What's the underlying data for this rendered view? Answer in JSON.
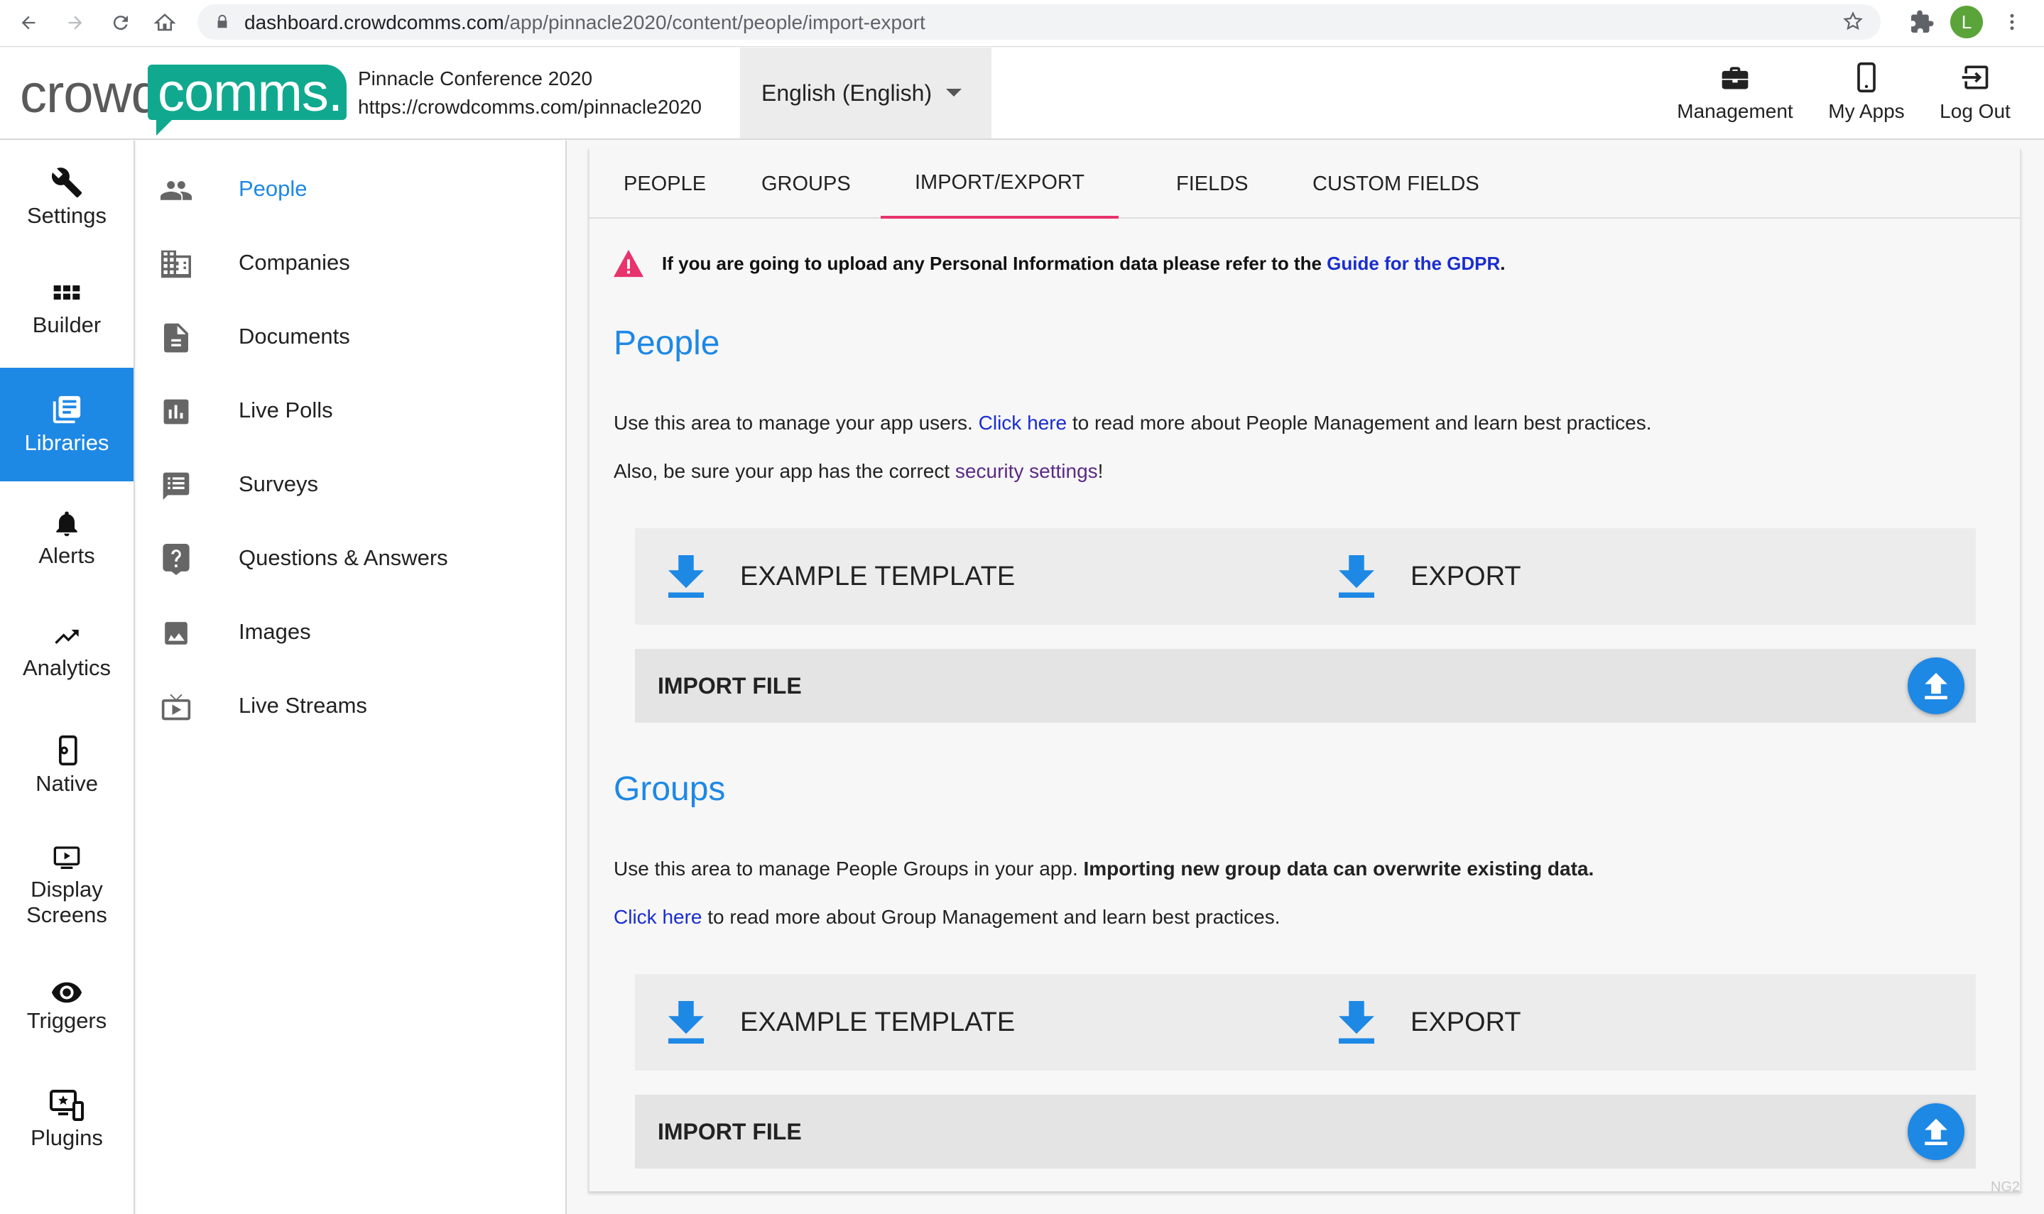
{
  "browser": {
    "url_host": "dashboard.crowdcomms.com",
    "url_path": "/app/pinnacle2020/content/people/import-export",
    "profile_initial": "L"
  },
  "header": {
    "logo_crowd": "crowd",
    "logo_comms": "comms.",
    "event_name": "Pinnacle Conference 2020",
    "event_url": "https://crowdcomms.com/pinnacle2020",
    "language": "English (English)",
    "actions": [
      {
        "label": "Management",
        "icon": "briefcase-icon"
      },
      {
        "label": "My Apps",
        "icon": "phone-icon"
      },
      {
        "label": "Log Out",
        "icon": "logout-icon"
      }
    ]
  },
  "rail": {
    "items": [
      {
        "label": "Settings",
        "icon": "wrench-icon"
      },
      {
        "label": "Builder",
        "icon": "grid-icon"
      },
      {
        "label": "Libraries",
        "icon": "library-icon",
        "active": true
      },
      {
        "label": "Alerts",
        "icon": "bell-icon"
      },
      {
        "label": "Analytics",
        "icon": "trending-up-icon"
      },
      {
        "label": "Native",
        "icon": "mobile-settings-icon"
      },
      {
        "label": "Display",
        "label2": "Screens",
        "icon": "display-icon"
      },
      {
        "label": "Triggers",
        "icon": "eye-icon"
      },
      {
        "label": "Plugins",
        "icon": "plugin-icon"
      }
    ]
  },
  "submenu": {
    "items": [
      {
        "label": "People",
        "icon": "people-icon",
        "active": true
      },
      {
        "label": "Companies",
        "icon": "building-icon"
      },
      {
        "label": "Documents",
        "icon": "document-icon"
      },
      {
        "label": "Live Polls",
        "icon": "poll-icon"
      },
      {
        "label": "Surveys",
        "icon": "survey-icon"
      },
      {
        "label": "Questions & Answers",
        "icon": "question-icon"
      },
      {
        "label": "Images",
        "icon": "image-icon"
      },
      {
        "label": "Live Streams",
        "icon": "live-tv-icon"
      }
    ]
  },
  "tabs": [
    "PEOPLE",
    "GROUPS",
    "IMPORT/EXPORT",
    "FIELDS",
    "CUSTOM FIELDS"
  ],
  "active_tab": "IMPORT/EXPORT",
  "gdpr": {
    "text": "If you are going to upload any Personal Information data please refer to the ",
    "link": "Guide for the GDPR",
    "end": "."
  },
  "people": {
    "title": "People",
    "p1_before": "Use this area to manage your app users. ",
    "p1_link": "Click here",
    "p1_after": " to read more about People Management and learn best practices.",
    "p2_before": "Also, be sure your app has the correct ",
    "p2_link": "security settings",
    "p2_after": "!",
    "template_label": "EXAMPLE TEMPLATE",
    "export_label": "EXPORT",
    "import_label": "IMPORT FILE"
  },
  "groups": {
    "title": "Groups",
    "p1_before": "Use this area to manage People Groups in your app. ",
    "p1_bold": "Importing new group data can overwrite existing data.",
    "p2_link": "Click here",
    "p2_after": " to read more about Group Management and learn best practices.",
    "template_label": "EXAMPLE TEMPLATE",
    "export_label": "EXPORT",
    "import_label": "IMPORT FILE"
  },
  "corner_tag": "NG2",
  "colors": {
    "accent": "#1e88e5",
    "brand": "#10a98f",
    "tab_indicator": "#e8336d",
    "link": "#1a2dd0"
  }
}
